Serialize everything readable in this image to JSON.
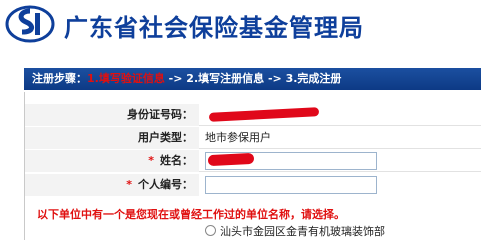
{
  "header": {
    "org_name": "广东省社会保险基金管理局",
    "logo_colors": {
      "ring": "#0e3f9b",
      "letter": "#0e3f9b"
    }
  },
  "steps": {
    "prefix": "注册步骤：",
    "current": "1.填写验证信息",
    "sep1": " -> ",
    "step2": "2.填写注册信息",
    "sep2": " -> ",
    "step3": "3.完成注册"
  },
  "form": {
    "id_label": "身份证号码：",
    "user_type_label": "用户类型：",
    "user_type_value": "地市参保用户",
    "name_label": "姓名：",
    "personal_no_label": "个人编号：",
    "required_mark": "*"
  },
  "notice": "以下单位中有一个是您现在或曾经工作过的单位名称，请选择。",
  "units": [
    {
      "label": "汕头市金园区金青有机玻璃装饰部",
      "selected": false
    }
  ],
  "colors": {
    "brand": "#0e3f9b",
    "alert": "#e01010",
    "redaction": "#e0081a"
  }
}
